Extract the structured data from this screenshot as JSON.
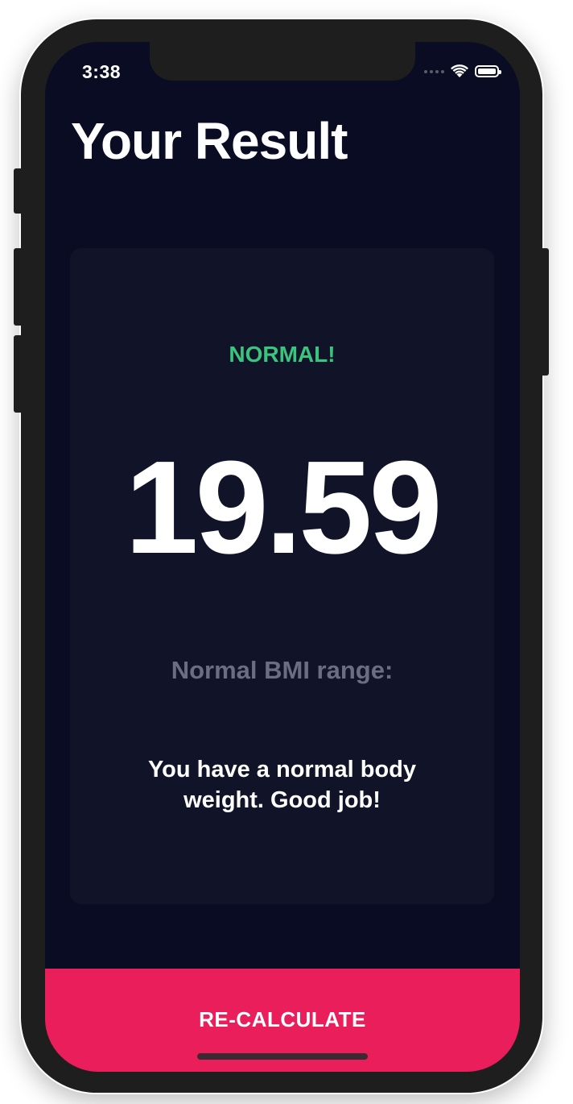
{
  "status_bar": {
    "time": "3:38",
    "icons": [
      "cellular-signal-icon",
      "wifi-icon",
      "battery-icon"
    ]
  },
  "page": {
    "title": "Your Result"
  },
  "result": {
    "status": "NORMAL!",
    "bmi": "19.59",
    "range_label": "Normal BMI range:",
    "interpretation": "You have a normal body weight. Good job!"
  },
  "actions": {
    "recalculate_label": "RE-CALCULATE"
  },
  "colors": {
    "background": "#090c22",
    "card": "#111428",
    "status_normal": "#3bc47e",
    "accent": "#e91e5a",
    "muted_text": "#6b6e82"
  }
}
